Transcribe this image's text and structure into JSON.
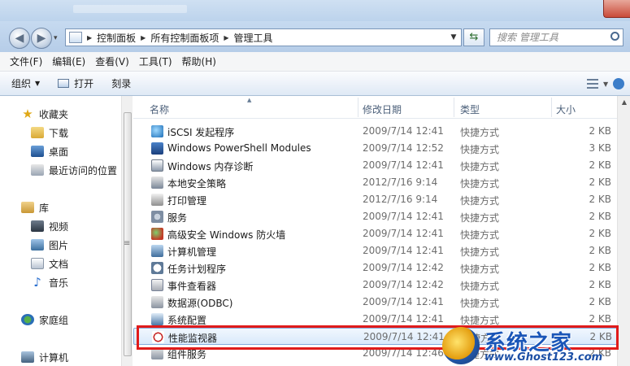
{
  "address": {
    "crumbs": [
      "控制面板",
      "所有控制面板项",
      "管理工具"
    ],
    "search_placeholder": "搜索 管理工具"
  },
  "menu": [
    "文件(F)",
    "编辑(E)",
    "查看(V)",
    "工具(T)",
    "帮助(H)"
  ],
  "toolbar": {
    "organize": "组织",
    "open": "打开",
    "burn": "刻录"
  },
  "nav": {
    "favorites": "收藏夹",
    "downloads": "下载",
    "desktop": "桌面",
    "recent": "最近访问的位置",
    "libraries": "库",
    "videos": "视频",
    "pictures": "图片",
    "documents": "文档",
    "music": "音乐",
    "homegroup": "家庭组",
    "computer": "计算机"
  },
  "columns": {
    "name": "名称",
    "date": "修改日期",
    "type": "类型",
    "size": "大小"
  },
  "files": [
    {
      "name": "iSCSI 发起程序",
      "date": "2009/7/14 12:41",
      "type": "快捷方式",
      "size": "2 KB",
      "icon": "iscsi-icon"
    },
    {
      "name": "Windows PowerShell Modules",
      "date": "2009/7/14 12:52",
      "type": "快捷方式",
      "size": "3 KB",
      "icon": "powershell-icon"
    },
    {
      "name": "Windows 内存诊断",
      "date": "2009/7/14 12:41",
      "type": "快捷方式",
      "size": "2 KB",
      "icon": "memory-diagnostic-icon"
    },
    {
      "name": "本地安全策略",
      "date": "2012/7/16 9:14",
      "type": "快捷方式",
      "size": "2 KB",
      "icon": "security-policy-icon"
    },
    {
      "name": "打印管理",
      "date": "2012/7/16 9:14",
      "type": "快捷方式",
      "size": "2 KB",
      "icon": "printer-icon"
    },
    {
      "name": "服务",
      "date": "2009/7/14 12:41",
      "type": "快捷方式",
      "size": "2 KB",
      "icon": "services-gear-icon"
    },
    {
      "name": "高级安全 Windows 防火墙",
      "date": "2009/7/14 12:41",
      "type": "快捷方式",
      "size": "2 KB",
      "icon": "firewall-icon"
    },
    {
      "name": "计算机管理",
      "date": "2009/7/14 12:41",
      "type": "快捷方式",
      "size": "2 KB",
      "icon": "computer-management-icon"
    },
    {
      "name": "任务计划程序",
      "date": "2009/7/14 12:42",
      "type": "快捷方式",
      "size": "2 KB",
      "icon": "task-scheduler-clock-icon"
    },
    {
      "name": "事件查看器",
      "date": "2009/7/14 12:42",
      "type": "快捷方式",
      "size": "2 KB",
      "icon": "event-viewer-icon"
    },
    {
      "name": "数据源(ODBC)",
      "date": "2009/7/14 12:41",
      "type": "快捷方式",
      "size": "2 KB",
      "icon": "odbc-icon"
    },
    {
      "name": "系统配置",
      "date": "2009/7/14 12:41",
      "type": "快捷方式",
      "size": "2 KB",
      "icon": "system-config-icon"
    },
    {
      "name": "性能监视器",
      "date": "2009/7/14 12:41",
      "type": "快捷方式",
      "size": "2 KB",
      "icon": "performance-monitor-icon",
      "selected": true
    },
    {
      "name": "组件服务",
      "date": "2009/7/14 12:46",
      "type": "快捷方式",
      "size": "2 KB",
      "icon": "component-services-icon"
    }
  ],
  "watermark": {
    "title": "系统之家",
    "url": "www.Ghost123.com"
  }
}
